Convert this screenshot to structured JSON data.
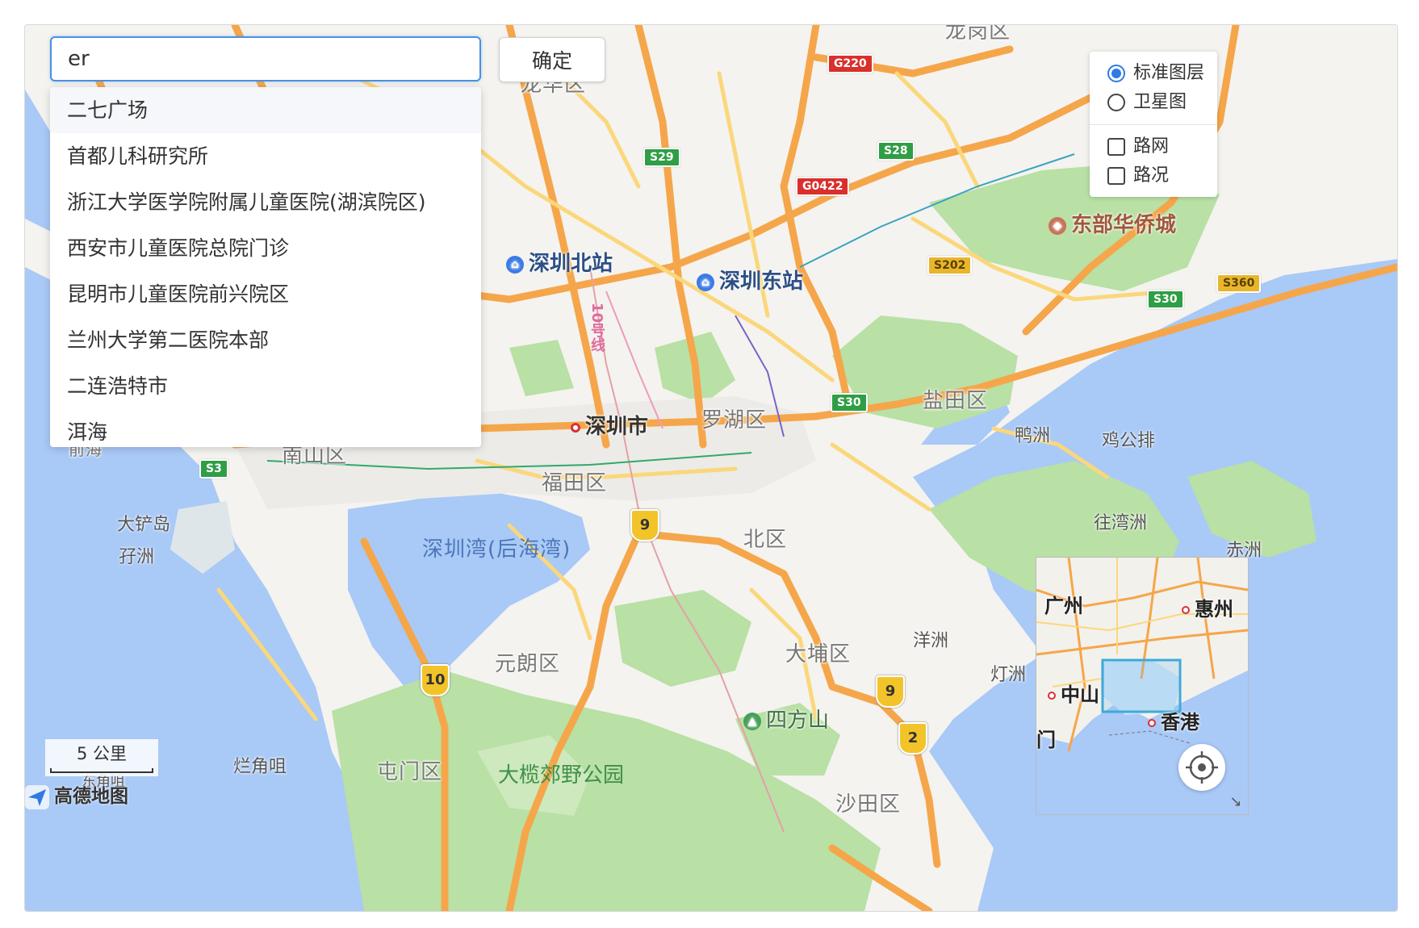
{
  "search": {
    "value": "er",
    "confirm_label": "确定"
  },
  "suggestions": [
    "二七广场",
    "首都儿科研究所",
    "浙江大学医学院附属儿童医院(湖滨院区)",
    "西安市儿童医院总院门诊",
    "昆明市儿童医院前兴院区",
    "兰州大学第二医院本部",
    "二连浩特市",
    "洱海"
  ],
  "layers": {
    "base": [
      {
        "label": "标准图层",
        "selected": true
      },
      {
        "label": "卫星图",
        "selected": false
      }
    ],
    "overlays": [
      {
        "label": "路网",
        "checked": false
      },
      {
        "label": "路况",
        "checked": false
      }
    ]
  },
  "map_labels": {
    "districts": {
      "longgang": "龙岗区",
      "longhua": "龙华区",
      "luohu": "罗湖区",
      "yantian": "盐田区",
      "nanshan": "南山区",
      "futian": "福田区",
      "yuanlang": "元朗区",
      "north": "北区",
      "dapu": "大埔区",
      "tunmen": "屯门区",
      "shatian": "沙田区",
      "qianhai": "前海"
    },
    "pois": {
      "sz_north": "深圳北站",
      "sz_east": "深圳东站",
      "sz_city": "深圳市",
      "octcity": "东部华侨城",
      "sifangshan": "四方山"
    },
    "water": {
      "shenzhen_bay": "深圳湾(后海湾)"
    },
    "parks": {
      "tailangjiao": "大榄郊野公园"
    },
    "places": {
      "yazhou": "鸭洲",
      "jiwangpai": "鸡公排",
      "wangwanzhou": "往湾洲",
      "chizhou": "赤洲",
      "yangzhou": "洋洲",
      "dengzhou": "灯洲",
      "dachandao": "大铲岛",
      "ruzhou": "孖洲",
      "lanjiaozhuo": "烂角咀",
      "dongjiaozhuo": "东角咀"
    },
    "metro_line": "10号线",
    "shields": {
      "g220": "G220",
      "s29": "S29",
      "s28": "S28",
      "g0422": "G0422",
      "s202": "S202",
      "s30a": "S30",
      "s30b": "S30",
      "s360": "S360",
      "s3": "S3"
    },
    "routes": {
      "r9a": "9",
      "r9b": "9",
      "r10": "10",
      "r2": "2"
    }
  },
  "overview": {
    "guangzhou": "广州",
    "huizhou": "惠州",
    "zhongshan": "中山",
    "hongkong": "香港",
    "aomen": "门"
  },
  "scale": {
    "label": "5 公里"
  },
  "logo": {
    "text": "高德地图"
  },
  "colors": {
    "water": "#a9c9f7",
    "green": "#b9e0a5",
    "highway": "#f5a64a",
    "road": "#fbd77b",
    "accent": "#2f7ae5"
  }
}
